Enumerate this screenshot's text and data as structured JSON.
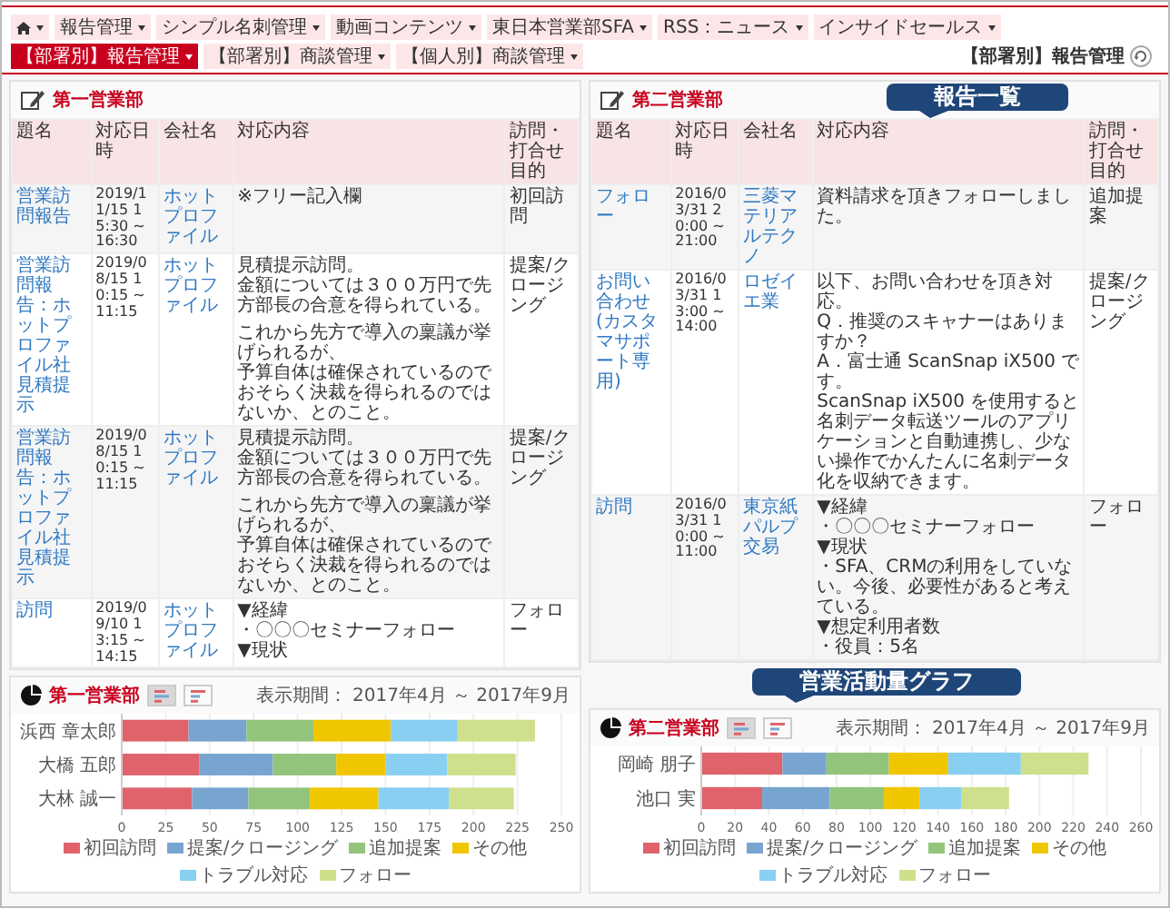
{
  "nav": {
    "tabs": [
      {
        "kind": "home",
        "selected": false
      },
      {
        "kind": "menu",
        "label": "報告管理",
        "selected": false
      },
      {
        "kind": "menu",
        "label": "シンプル名刺管理",
        "selected": false
      },
      {
        "kind": "menu",
        "label": "動画コンテンツ",
        "selected": false
      },
      {
        "kind": "menu",
        "label": "東日本営業部SFA",
        "selected": false
      },
      {
        "kind": "menu",
        "label": "RSS：ニュース",
        "selected": false
      },
      {
        "kind": "menu",
        "label": "インサイドセールス",
        "selected": false
      },
      {
        "kind": "menu",
        "label": "【部署別】報告管理",
        "selected": true
      },
      {
        "kind": "menu",
        "label": "【部署別】商談管理",
        "selected": false
      },
      {
        "kind": "menu",
        "label": "【個人別】商談管理",
        "selected": false
      }
    ]
  },
  "page_title": "【部署別】報告管理",
  "report_panels": [
    {
      "title": "第一営業部",
      "columns": [
        "題名",
        "対応日時",
        "会社名",
        "対応内容",
        "訪問・打合せ目的"
      ],
      "rows": [
        {
          "subject": "営業訪問報告",
          "datetime": "2019/11/15 15:30 ~ 16:30",
          "company": "ホットプロファイル",
          "content": [
            [
              "※フリー記入欄"
            ]
          ],
          "purpose": "初回訪問"
        },
        {
          "subject": "営業訪問報告：ホットプロファイル社見積提示",
          "datetime": "2019/08/15 10:15 ~ 11:15",
          "company": "ホットプロファイル",
          "content": [
            [
              "見積提示訪問。",
              "金額については３００万円で先方部長の合意を得られている。"
            ],
            [
              "これから先方で導入の稟議が挙げられるが、",
              "予算自体は確保されているのでおそらく決裁を得られるのではないか、とのこと。"
            ]
          ],
          "purpose": "提案/クロージング"
        },
        {
          "subject": "営業訪問報告：ホットプロファイル社見積提示",
          "datetime": "2019/08/15 10:15 ~ 11:15",
          "company": "ホットプロファイル",
          "content": [
            [
              "見積提示訪問。",
              "金額については３００万円で先方部長の合意を得られている。"
            ],
            [
              "これから先方で導入の稟議が挙げられるが、",
              "予算自体は確保されているのでおそらく決裁を得られるのではないか、とのこと。"
            ]
          ],
          "purpose": "提案/クロージング"
        },
        {
          "subject": "訪問",
          "datetime": "2019/09/10 13:15 ~ 14:15",
          "company": "ホットプロファイル",
          "content": [
            [
              "▼経緯",
              "・〇〇〇セミナーフォロー",
              "▼現状"
            ]
          ],
          "purpose": "フォロー"
        }
      ]
    },
    {
      "title": "第二営業部",
      "columns": [
        "題名",
        "対応日時",
        "会社名",
        "対応内容",
        "訪問・打合せ目的"
      ],
      "callout": "報告一覧",
      "rows": [
        {
          "subject": "フォロー",
          "datetime": "2016/03/31 20:00 ~ 21:00",
          "company": "三菱マテリアルテクノ",
          "content": [
            [
              "資料請求を頂きフォローしました。"
            ]
          ],
          "purpose": "追加提案"
        },
        {
          "subject": "お問い合わせ(カスタマサポート専用)",
          "datetime": "2016/03/31 13:00 ~ 14:00",
          "company": "ロゼイエ業",
          "content": [
            [
              "以下、お問い合わせを頂き対応。",
              "Q．推奨のスキャナーはありますか？",
              "A．富士通 ScanSnap iX500 です。",
              "ScanSnap iX500 を使用すると名刺データ転送ツールのアプリケーションと自動連携し、少ない操作でかんたんに名刺データ化を収納できます。"
            ]
          ],
          "purpose": "提案/クロージング"
        },
        {
          "subject": "訪問",
          "datetime": "2016/03/31 10:00 ~ 11:00",
          "company": "東京紙パルプ交易",
          "content": [
            [
              "▼経緯",
              "・〇〇〇セミナーフォロー",
              "▼現状",
              "・SFA、CRMの利用をしていない。今後、必要性があると考えている。",
              "▼想定利用者数",
              "・役員：5名"
            ]
          ],
          "purpose": "フォロー"
        }
      ]
    }
  ],
  "chart_panels": [
    {
      "title": "第一営業部",
      "period": "表示期間： 2017年4月 ～ 2017年9月",
      "views": [
        {
          "selected": true
        },
        {
          "selected": false
        }
      ],
      "chart_data": {
        "type": "bar",
        "orientation": "horizontal",
        "stacked": true,
        "grid": true,
        "categories": [
          "浜西 章太郎",
          "大橋 五郎",
          "大林 誠一"
        ],
        "xlim": [
          0,
          250
        ],
        "xticks": [
          0,
          25,
          50,
          75,
          100,
          125,
          150,
          175,
          200,
          225,
          250
        ],
        "series": [
          {
            "name": "初回訪問",
            "color": "#e0636b",
            "values": [
              38,
              44,
              40
            ]
          },
          {
            "name": "提案/クロージング",
            "color": "#78a5d0",
            "values": [
              33,
              42,
              32
            ]
          },
          {
            "name": "追加提案",
            "color": "#93c47b",
            "values": [
              38,
              36,
              35
            ]
          },
          {
            "name": "その他",
            "color": "#f0c600",
            "values": [
              44,
              28,
              39
            ]
          },
          {
            "name": "トラブル対応",
            "color": "#88cff2",
            "values": [
              38,
              35,
              40
            ]
          },
          {
            "name": "フォロー",
            "color": "#cfe08d",
            "values": [
              44,
              39,
              37
            ]
          }
        ]
      }
    },
    {
      "title": "第二営業部",
      "period": "表示期間： 2017年4月 ～ 2017年9月",
      "callout": "営業活動量グラフ",
      "views": [
        {
          "selected": true
        },
        {
          "selected": false
        }
      ],
      "chart_data": {
        "type": "bar",
        "orientation": "horizontal",
        "stacked": true,
        "grid": true,
        "categories": [
          "岡崎 朋子",
          "池口 実"
        ],
        "xlim": [
          0,
          260
        ],
        "xticks": [
          0,
          20,
          40,
          60,
          80,
          100,
          120,
          140,
          160,
          180,
          200,
          220,
          240,
          260
        ],
        "series": [
          {
            "name": "初回訪問",
            "color": "#e0636b",
            "values": [
              48,
              36
            ]
          },
          {
            "name": "提案/クロージング",
            "color": "#78a5d0",
            "values": [
              26,
              40
            ]
          },
          {
            "name": "追加提案",
            "color": "#93c47b",
            "values": [
              37,
              32
            ]
          },
          {
            "name": "その他",
            "color": "#f0c600",
            "values": [
              35,
              21
            ]
          },
          {
            "name": "トラブル対応",
            "color": "#88cff2",
            "values": [
              43,
              25
            ]
          },
          {
            "name": "フォロー",
            "color": "#cfe08d",
            "values": [
              40,
              28
            ]
          }
        ]
      }
    }
  ]
}
